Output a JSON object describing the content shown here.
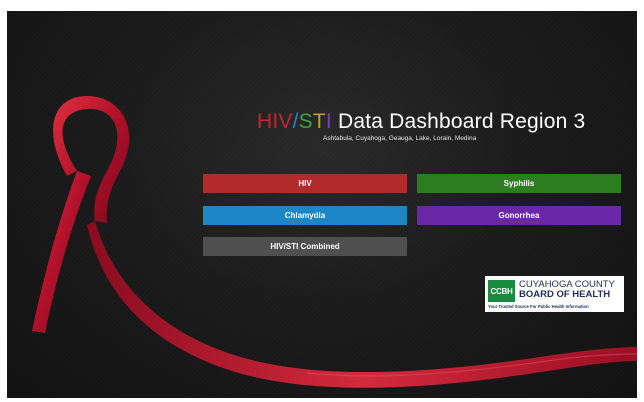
{
  "header": {
    "title_hiv": "HIV",
    "title_slash": "/",
    "title_sti_s": "S",
    "title_sti_t": "T",
    "title_sti_i": "I",
    "title_rest": " Data Dashboard Region 3",
    "subtitle": "Ashtabula, Cuyahoga, Geauga, Lake, Lorain, Medina"
  },
  "buttons": {
    "hiv": "HIV",
    "syphilis": "Syphilis",
    "chlamydia": "Chlamydia",
    "gonorrhea": "Gonorrhea",
    "combined": "HIV/STI Combined"
  },
  "logo": {
    "mark": "CCBH",
    "line1": "CUYAHOGA COUNTY",
    "line2": "BOARD OF HEALTH",
    "tagline": "Your Trusted Source For Public Health Information"
  },
  "colors": {
    "hiv": "#b22a2a",
    "syphilis": "#2c7d1f",
    "chlamydia": "#1d86c6",
    "gonorrhea": "#6a28a8",
    "combined": "#4f4f4f",
    "ribbon": "#c8102e"
  },
  "icons": {
    "background_art": "red-awareness-ribbon"
  }
}
